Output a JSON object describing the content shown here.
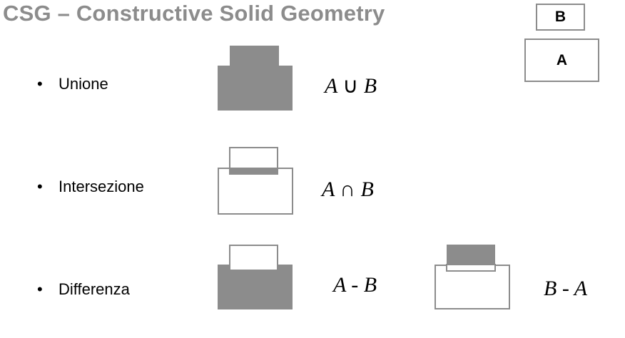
{
  "title": "CSG – Constructive Solid Geometry",
  "legend": {
    "b_label": "B",
    "a_label": "A"
  },
  "operations": [
    {
      "label": "Unione",
      "formula_left": "A",
      "formula_op": "∪",
      "formula_right": "B"
    },
    {
      "label": "Intersezione",
      "formula_left": "A",
      "formula_op": "∩",
      "formula_right": "B"
    },
    {
      "label": "Differenza",
      "formula_left": "A",
      "formula_op": "-",
      "formula_right": "B"
    }
  ],
  "extra_formula": {
    "formula_left": "B",
    "formula_op": "-",
    "formula_right": "A"
  },
  "colors": {
    "fill": "#8c8c8c",
    "stroke": "#8c8c8c",
    "title": "#8c8c8c"
  }
}
